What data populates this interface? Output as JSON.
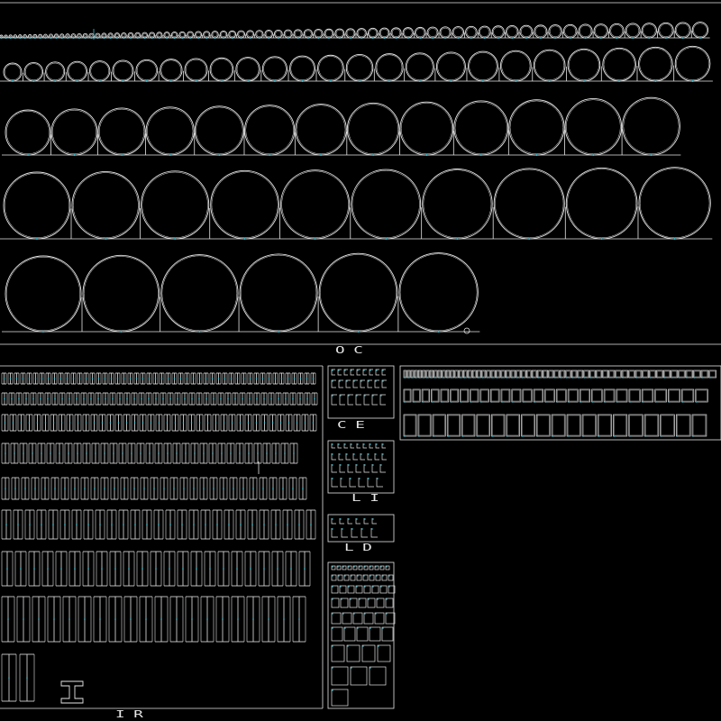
{
  "drawing": {
    "background": "#000000",
    "line_color": "#e6e6e6",
    "accent_color": "#35c6d8",
    "groups": {
      "oc": {
        "label": "OC",
        "description_icon": "circular-tube-sections"
      },
      "ir": {
        "label": "IR",
        "description_icon": "i-beam-sections"
      },
      "ce": {
        "label": "CE",
        "description_icon": "channel-sections"
      },
      "li": {
        "label": "LI",
        "description_icon": "equal-angle-sections"
      },
      "ld": {
        "label": "LD",
        "description_icon": "unequal-angle-sections"
      },
      "box": {
        "label": "",
        "description_icon": "square-tube-sections"
      },
      "rect": {
        "label": "",
        "description_icon": "rectangular-tube-sections"
      }
    }
  }
}
